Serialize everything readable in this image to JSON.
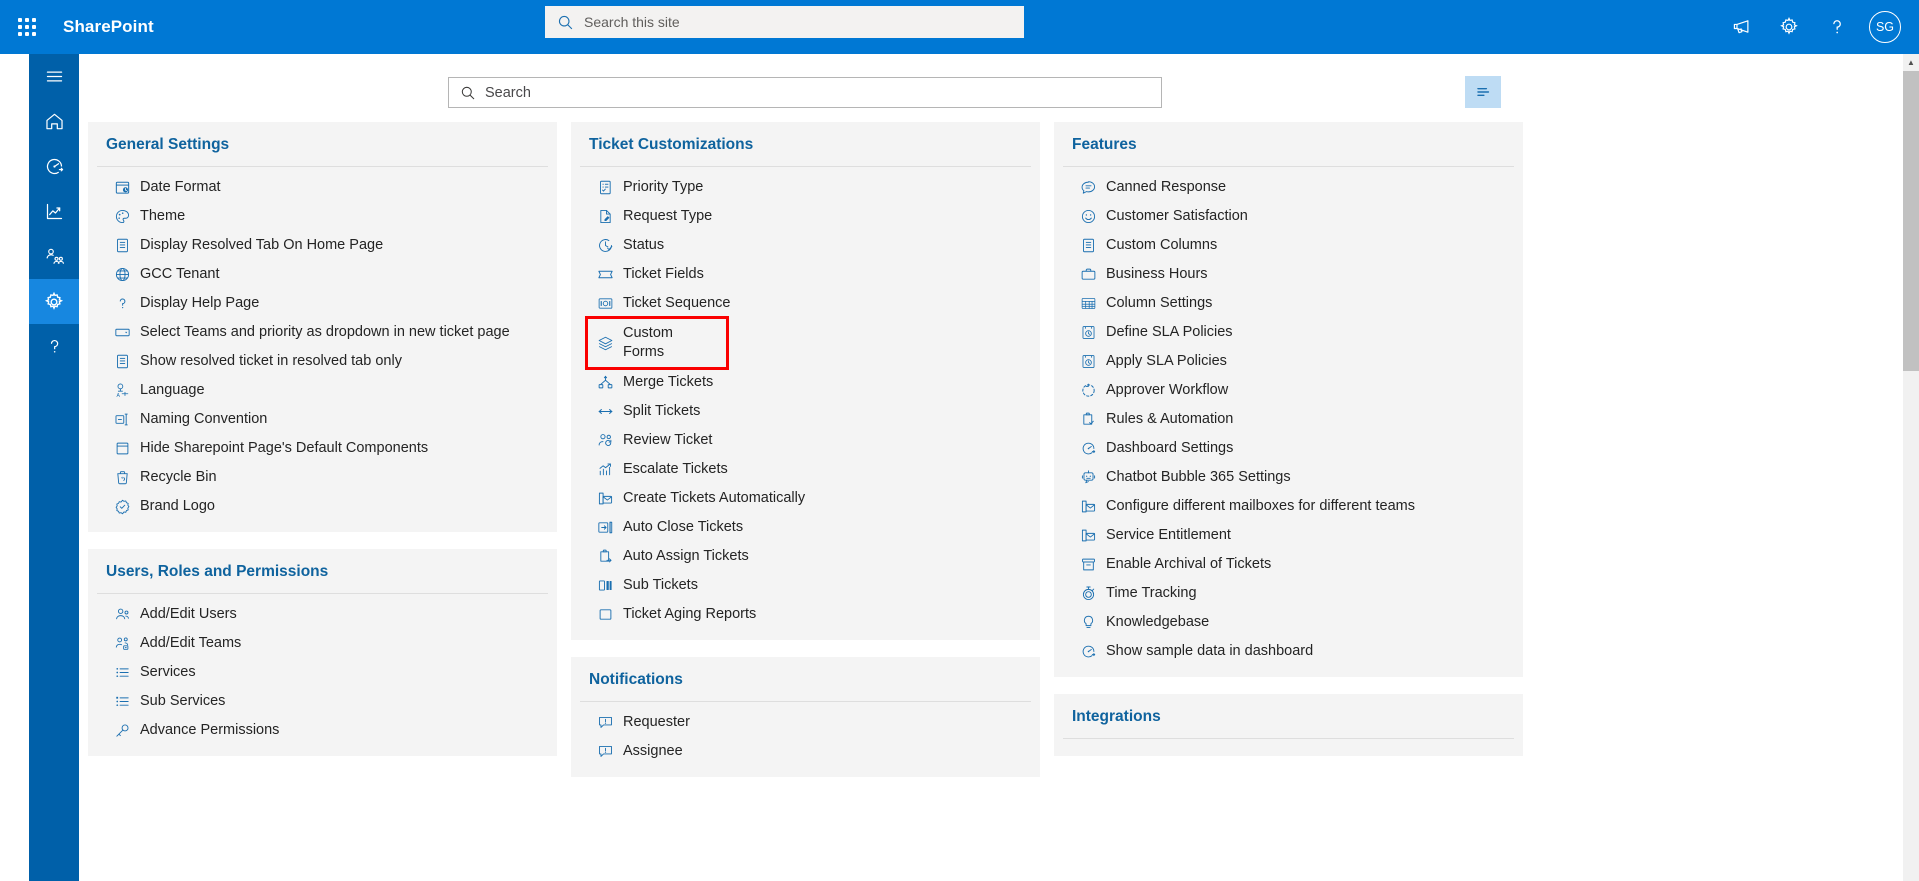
{
  "suite": {
    "brand": "SharePoint",
    "search_placeholder": "Search this site",
    "search_value": "",
    "waffle_icon": "app-launcher-icon",
    "icons": [
      {
        "name": "megaphone-icon",
        "label": "Announcements"
      },
      {
        "name": "gear-icon",
        "label": "Settings"
      },
      {
        "name": "help-icon",
        "label": "Help"
      }
    ],
    "avatar_initials": "SG",
    "accent_color": "#0078d4"
  },
  "rail": {
    "background_color": "#0060a9",
    "active_color": "#1787e0",
    "items": [
      {
        "name": "hamburger-menu-icon",
        "label": "Menu",
        "active": false
      },
      {
        "name": "home-icon",
        "label": "Home",
        "active": false
      },
      {
        "name": "dashboard-gauge-icon",
        "label": "Dashboard",
        "active": false
      },
      {
        "name": "analytics-chart-icon",
        "label": "Analytics",
        "active": false
      },
      {
        "name": "teams-people-icon",
        "label": "Teams",
        "active": false
      },
      {
        "name": "settings-gear-icon",
        "label": "Settings",
        "active": true
      },
      {
        "name": "help-question-icon",
        "label": "Help",
        "active": false
      }
    ]
  },
  "toolbar": {
    "search_placeholder": "Search",
    "search_value": "",
    "search_icon": "search-icon",
    "filter_button_icon": "filter-list-icon",
    "filter_button_color": "#bedcf4"
  },
  "highlight": {
    "color": "#fa0000",
    "target": "Custom Forms"
  },
  "columns": [
    {
      "cards": [
        {
          "title": "General Settings",
          "items": [
            {
              "label": "Date Format",
              "icon": "calendar-clock-icon"
            },
            {
              "label": "Theme",
              "icon": "palette-icon"
            },
            {
              "label": "Display Resolved Tab On Home Page",
              "icon": "document-list-icon"
            },
            {
              "label": "GCC Tenant",
              "icon": "globe-icon"
            },
            {
              "label": "Display Help Page",
              "icon": "question-mark-icon"
            },
            {
              "label": "Select Teams and priority as dropdown in new ticket page",
              "icon": "dropdown-box-icon"
            },
            {
              "label": "Show resolved ticket in resolved tab only",
              "icon": "document-list-icon"
            },
            {
              "label": "Language",
              "icon": "language-translate-icon"
            },
            {
              "label": "Naming Convention",
              "icon": "rename-icon"
            },
            {
              "label": "Hide Sharepoint Page's Default Components",
              "icon": "window-icon"
            },
            {
              "label": "Recycle Bin",
              "icon": "recycle-bin-icon"
            },
            {
              "label": "Brand Logo",
              "icon": "badge-check-icon"
            }
          ]
        },
        {
          "title": "Users, Roles and Permissions",
          "items": [
            {
              "label": "Add/Edit Users",
              "icon": "people-icon"
            },
            {
              "label": "Add/Edit Teams",
              "icon": "people-team-icon"
            },
            {
              "label": "Services",
              "icon": "bullet-list-icon"
            },
            {
              "label": "Sub Services",
              "icon": "sub-list-icon"
            },
            {
              "label": "Advance Permissions",
              "icon": "key-icon"
            }
          ]
        }
      ]
    },
    {
      "cards": [
        {
          "title": "Ticket Customizations",
          "items": [
            {
              "label": "Priority Type",
              "icon": "priority-list-icon"
            },
            {
              "label": "Request Type",
              "icon": "document-edit-icon"
            },
            {
              "label": "Status",
              "icon": "clock-check-icon"
            },
            {
              "label": "Ticket Fields",
              "icon": "ticket-icon"
            },
            {
              "label": "Ticket Sequence",
              "icon": "sequence-number-icon"
            },
            {
              "label": "Custom Forms",
              "icon": "layers-stack-icon",
              "highlighted": true
            },
            {
              "label": "Merge Tickets",
              "icon": "merge-icon"
            },
            {
              "label": "Split Tickets",
              "icon": "split-arrows-icon"
            },
            {
              "label": "Review Ticket",
              "icon": "person-review-icon"
            },
            {
              "label": "Escalate Tickets",
              "icon": "escalate-chart-icon"
            },
            {
              "label": "Create Tickets Automatically",
              "icon": "mail-create-icon"
            },
            {
              "label": "Auto Close Tickets",
              "icon": "auto-close-icon"
            },
            {
              "label": "Auto Assign Tickets",
              "icon": "clipboard-assign-icon"
            },
            {
              "label": "Sub Tickets",
              "icon": "columns-icon"
            },
            {
              "label": "Ticket Aging Reports",
              "icon": "square-outline-icon"
            }
          ]
        },
        {
          "title": "Notifications",
          "items": [
            {
              "label": "Requester",
              "icon": "alert-comment-icon"
            },
            {
              "label": "Assignee",
              "icon": "alert-comment-icon"
            }
          ]
        }
      ]
    },
    {
      "cards": [
        {
          "title": "Features",
          "items": [
            {
              "label": "Canned Response",
              "icon": "comment-lines-icon"
            },
            {
              "label": "Customer Satisfaction",
              "icon": "smiley-icon"
            },
            {
              "label": "Custom Columns",
              "icon": "document-list-icon"
            },
            {
              "label": "Business Hours",
              "icon": "briefcase-icon"
            },
            {
              "label": "Column Settings",
              "icon": "grid-columns-icon"
            },
            {
              "label": "Define SLA Policies",
              "icon": "sla-clock-icon"
            },
            {
              "label": "Apply SLA Policies",
              "icon": "sla-clock-icon"
            },
            {
              "label": "Approver Workflow",
              "icon": "workflow-circle-icon"
            },
            {
              "label": "Rules & Automation",
              "icon": "clipboard-check-icon"
            },
            {
              "label": "Dashboard Settings",
              "icon": "dashboard-gauge-icon"
            },
            {
              "label": "Chatbot Bubble 365 Settings",
              "icon": "chatbot-icon"
            },
            {
              "label": "Configure different mailboxes for different teams",
              "icon": "mail-create-icon"
            },
            {
              "label": "Service Entitlement",
              "icon": "mail-create-icon"
            },
            {
              "label": "Enable Archival of Tickets",
              "icon": "archive-icon"
            },
            {
              "label": "Time Tracking",
              "icon": "stopwatch-icon"
            },
            {
              "label": "Knowledgebase",
              "icon": "lightbulb-icon"
            },
            {
              "label": "Show sample data in dashboard",
              "icon": "dashboard-gauge-icon"
            }
          ]
        },
        {
          "title": "Integrations",
          "items": []
        }
      ]
    }
  ]
}
